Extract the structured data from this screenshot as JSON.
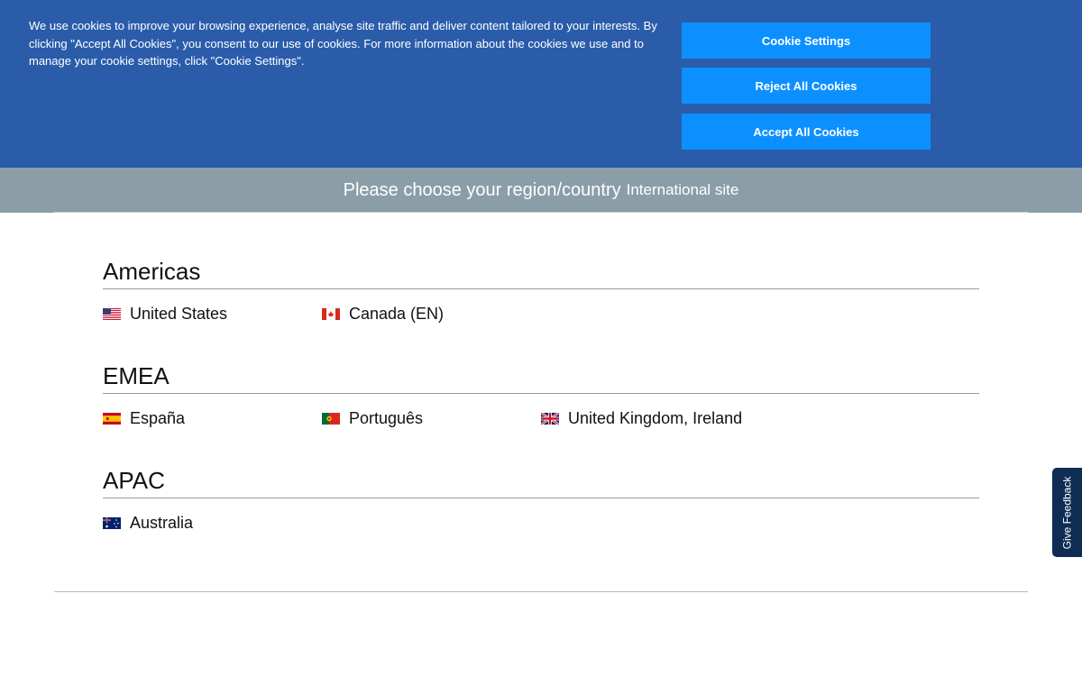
{
  "cookie_banner": {
    "text": "We use cookies to improve your browsing experience, analyse site traffic and deliver content tailored to your interests. By clicking \"Accept All Cookies\", you consent to our use of cookies. For more information about the cookies we use and to manage your cookie settings, click \"Cookie Settings\".",
    "settings_label": "Cookie Settings",
    "reject_label": "Reject All Cookies",
    "accept_label": "Accept All Cookies",
    "colors": {
      "banner": "#2a5caa",
      "button": "#0d90ff"
    }
  },
  "header": {
    "title": "Please choose your region/country",
    "international_link": "International site"
  },
  "regions": [
    {
      "name": "Americas",
      "countries": [
        {
          "label": "United States",
          "flag": "us-flag-icon"
        },
        {
          "label": "Canada (EN)",
          "flag": "canada-flag-icon"
        }
      ]
    },
    {
      "name": "EMEA",
      "countries": [
        {
          "label": "España",
          "flag": "spain-flag-icon"
        },
        {
          "label": "Português",
          "flag": "portugal-flag-icon"
        },
        {
          "label": "United Kingdom, Ireland",
          "flag": "uk-flag-icon"
        }
      ]
    },
    {
      "name": "APAC",
      "countries": [
        {
          "label": "Australia",
          "flag": "australia-flag-icon"
        }
      ]
    }
  ],
  "feedback": {
    "label": "Give Feedback"
  }
}
